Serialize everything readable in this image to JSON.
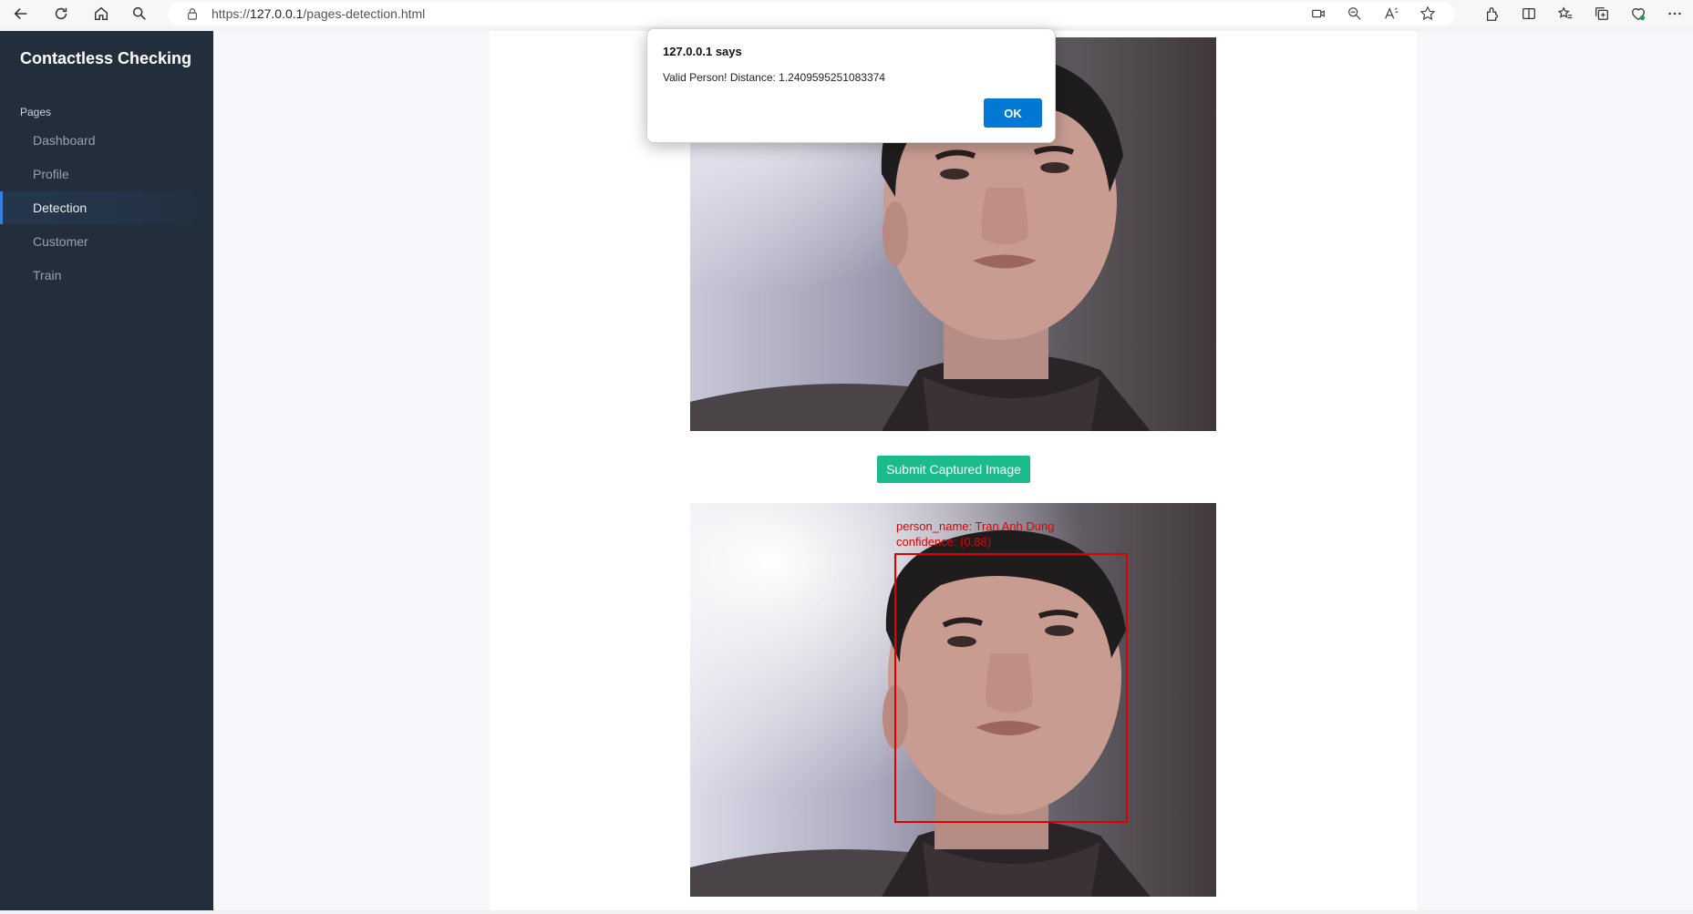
{
  "browser": {
    "url_scheme": "https://",
    "url_host": "127.0.0.1",
    "url_path": "/pages-detection.html"
  },
  "sidebar": {
    "brand": "Contactless Checking",
    "section_title": "Pages",
    "items": [
      {
        "label": "Dashboard"
      },
      {
        "label": "Profile"
      },
      {
        "label": "Detection"
      },
      {
        "label": "Customer"
      },
      {
        "label": "Train"
      }
    ],
    "active_item": "Detection"
  },
  "main": {
    "submit_label": "Submit Captured Image",
    "detection": {
      "person_line": "person_name: Tran Anh Dung",
      "confidence_line": "confidence: (0.88)"
    }
  },
  "dialog": {
    "title": "127.0.0.1 says",
    "message": "Valid Person! Distance: 1.2409595251083374",
    "ok_label": "OK"
  },
  "colors": {
    "sidebar_bg": "#222e3c",
    "accent": "#3b7ddd",
    "submit_bg": "#1cbb8c",
    "dialog_ok": "#0078d4",
    "bbox": "#e00000"
  }
}
